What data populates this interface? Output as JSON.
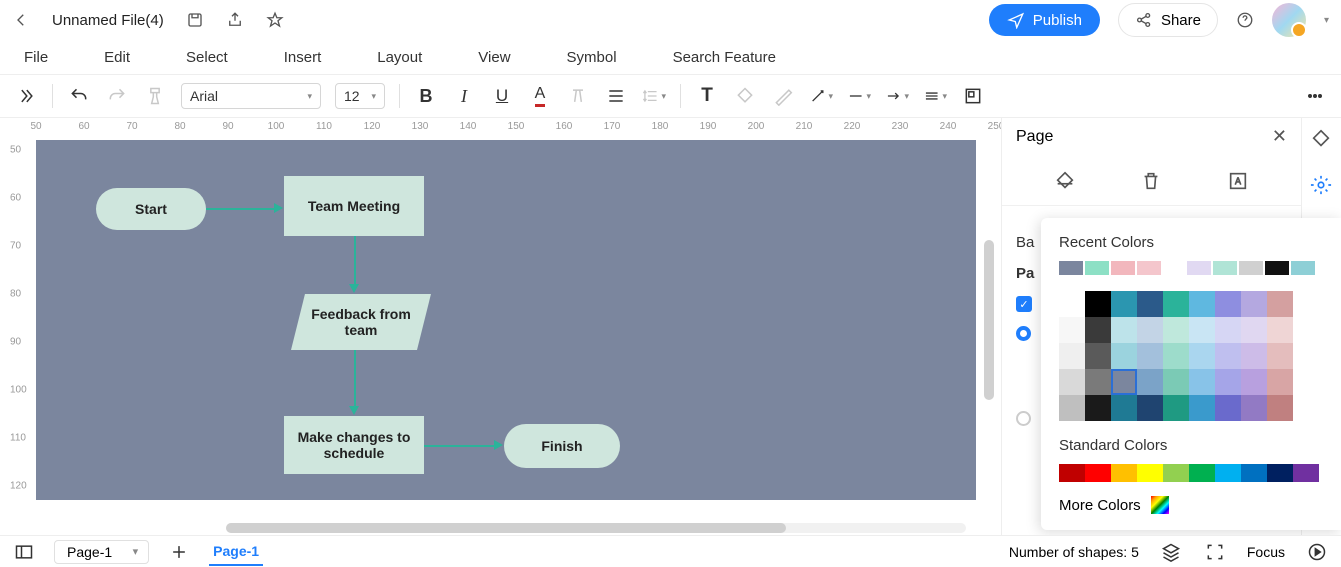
{
  "titlebar": {
    "filename": "Unnamed File(4)",
    "publish": "Publish",
    "share": "Share"
  },
  "menubar": {
    "items": [
      "File",
      "Edit",
      "Select",
      "Insert",
      "Layout",
      "View",
      "Symbol",
      "Search Feature"
    ]
  },
  "toolbar": {
    "font": "Arial",
    "size": "12"
  },
  "ruler_h": [
    "50",
    "60",
    "70",
    "80",
    "90",
    "100",
    "110",
    "120",
    "130",
    "140",
    "150",
    "160",
    "170",
    "180",
    "190",
    "200",
    "210",
    "220",
    "230",
    "240",
    "250"
  ],
  "ruler_v": [
    "50",
    "60",
    "70",
    "80",
    "90",
    "100",
    "110",
    "120"
  ],
  "shapes": {
    "start": "Start",
    "meeting": "Team Meeting",
    "feedback": "Feedback from team",
    "changes": "Make changes to schedule",
    "finish": "Finish"
  },
  "panel": {
    "title": "Page",
    "ba": "Ba",
    "pa": "Pa"
  },
  "popup": {
    "recent_title": "Recent Colors",
    "recent": [
      "#7b869e",
      "#8de0c5",
      "#f2b7bd",
      "#f4c6cc",
      "#e1d9f2",
      "#b0e4d6",
      "#d0d0d0",
      "#111111",
      "#8ecfd6"
    ],
    "grid": [
      [
        "#ffffff",
        "#000000",
        "#2b96b0",
        "#2b5a8a",
        "#2bb39a",
        "#5fb8e0",
        "#8e8ee0",
        "#b4a8e0",
        "#d4a0a0"
      ],
      [
        "#f7f7f7",
        "#3a3a3a",
        "#bde3ea",
        "#c3d4e6",
        "#bfe8dc",
        "#c9e5f4",
        "#d6d6f4",
        "#e0d7f1",
        "#efd5d5"
      ],
      [
        "#efefef",
        "#5a5a5a",
        "#9bd3de",
        "#a3c0dc",
        "#9ddccb",
        "#aad6ef",
        "#bfbfef",
        "#cdbce8",
        "#e4bdbd"
      ],
      [
        "#d9d9d9",
        "#7a7a7a",
        "#7b869e",
        "#7ba3c8",
        "#7bcab5",
        "#88c3e8",
        "#a5a5e8",
        "#b8a0df",
        "#d8a5a5"
      ],
      [
        "#bfbfbf",
        "#1a1a1a",
        "#1f7a94",
        "#1f4470",
        "#1f9a82",
        "#3a9acc",
        "#6a6acc",
        "#927ac4",
        "#c08080"
      ]
    ],
    "grid_sel_row": 3,
    "grid_sel_col": 2,
    "standard_title": "Standard Colors",
    "standard": [
      "#c00000",
      "#ff0000",
      "#ffc000",
      "#ffff00",
      "#92d050",
      "#00b050",
      "#00b0f0",
      "#0070c0",
      "#002060",
      "#7030a0"
    ],
    "more": "More Colors"
  },
  "status": {
    "page_selector": "Page-1",
    "active_page": "Page-1",
    "shapes": "Number of shapes: 5",
    "focus": "Focus"
  }
}
